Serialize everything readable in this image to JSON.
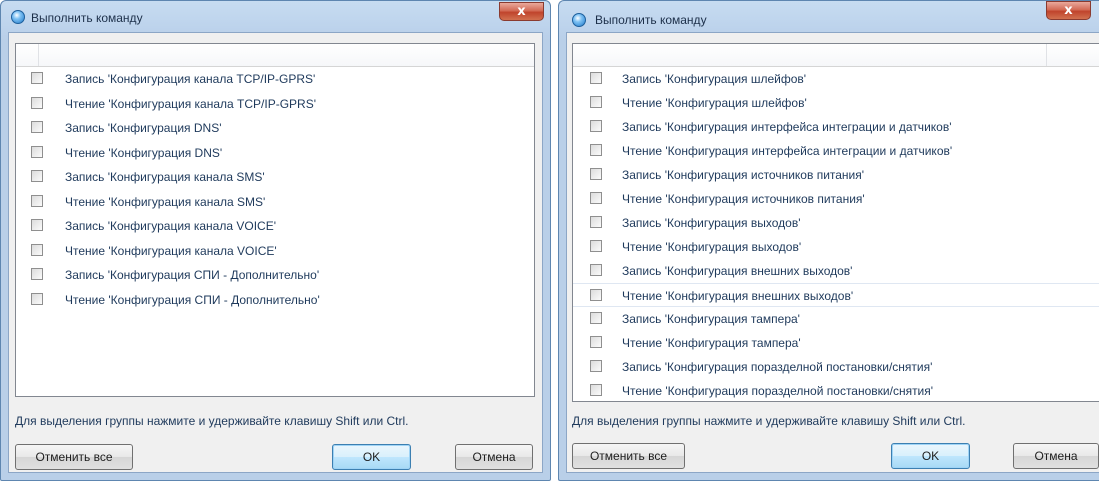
{
  "dialogs": [
    {
      "title": "Выполнить команду",
      "close_label": "x",
      "items": [
        "Запись 'Конфигурация канала TCP/IP-GPRS'",
        "Чтение 'Конфигурация канала TCP/IP-GPRS'",
        "Запись 'Конфигурация DNS'",
        "Чтение 'Конфигурация DNS'",
        "Запись 'Конфигурация канала SMS'",
        "Чтение 'Конфигурация канала SMS'",
        "Запись 'Конфигурация канала VOICE'",
        "Чтение 'Конфигурация канала VOICE'",
        "Запись 'Конфигурация СПИ - Дополнительно'",
        "Чтение 'Конфигурация СПИ - Дополнительно'"
      ],
      "hint": "Для выделения группы нажмите и удерживайте клавишу Shift или Ctrl.",
      "buttons": {
        "clear_all": "Отменить все",
        "ok": "OK",
        "cancel": "Отмена"
      }
    },
    {
      "title": "Выполнить команду",
      "close_label": "x",
      "items": [
        "Запись 'Конфигурация шлейфов'",
        "Чтение 'Конфигурация шлейфов'",
        "Запись 'Конфигурация интерфейса интеграции и датчиков'",
        "Чтение 'Конфигурация интерфейса интеграции и датчиков'",
        "Запись 'Конфигурация источников питания'",
        "Чтение 'Конфигурация источников питания'",
        "Запись 'Конфигурация выходов'",
        "Чтение 'Конфигурация выходов'",
        "Запись 'Конфигурация внешних выходов'",
        "Чтение 'Конфигурация внешних выходов'",
        "Запись 'Конфигурация тампера'",
        "Чтение 'Конфигурация тампера'",
        "Запись 'Конфигурация поразделной постановки/снятия'",
        "Чтение 'Конфигурация поразделной постановки/снятия'"
      ],
      "hint": "Для выделения группы нажмите и удерживайте клавишу Shift или Ctrl.",
      "buttons": {
        "clear_all": "Отменить все",
        "ok": "OK",
        "cancel": "Отмена"
      }
    }
  ]
}
